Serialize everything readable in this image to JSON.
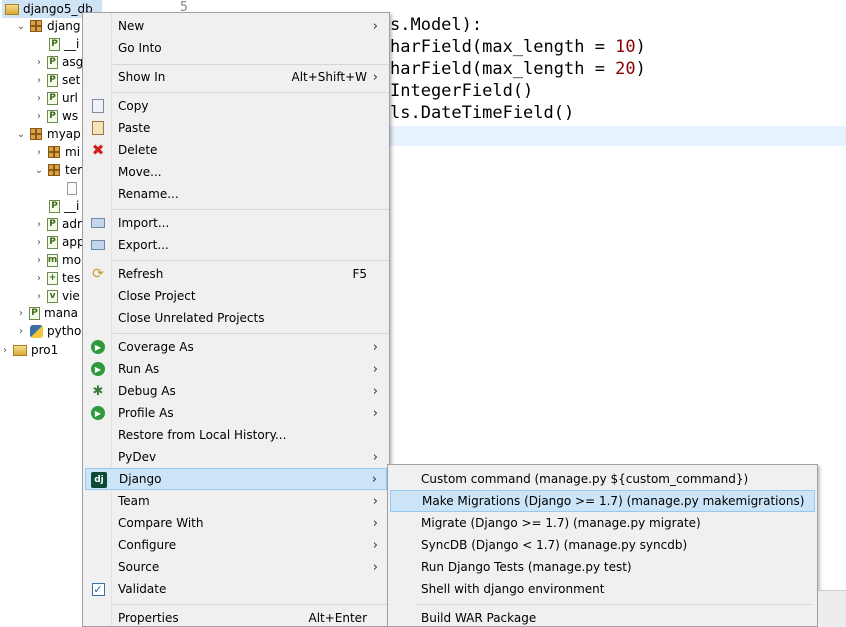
{
  "tree": {
    "items": [
      {
        "twisty": "⌄",
        "icon": "project-icon",
        "label": "django5_db"
      },
      {
        "twisty": "⌄",
        "icon": "package-icon",
        "label": "djang"
      },
      {
        "twisty": "",
        "icon": "python-file-icon",
        "label": "__i"
      },
      {
        "twisty": "›",
        "icon": "python-file-icon",
        "label": "asg"
      },
      {
        "twisty": "›",
        "icon": "python-file-icon",
        "label": "set"
      },
      {
        "twisty": "›",
        "icon": "python-file-icon",
        "label": "url"
      },
      {
        "twisty": "›",
        "icon": "python-file-icon",
        "label": "ws"
      },
      {
        "twisty": "⌄",
        "icon": "package-icon",
        "label": "myap"
      },
      {
        "twisty": "›",
        "icon": "package-icon",
        "label": "mi"
      },
      {
        "twisty": "⌄",
        "icon": "package-icon",
        "label": "ter"
      },
      {
        "twisty": "",
        "icon": "file-icon",
        "label": ""
      },
      {
        "twisty": "",
        "icon": "python-file-icon",
        "label": "__i"
      },
      {
        "twisty": "›",
        "icon": "python-file-icon",
        "label": "adr"
      },
      {
        "twisty": "›",
        "icon": "python-file-icon",
        "label": "app"
      },
      {
        "twisty": "›",
        "icon": "python-file-icon",
        "label": "mo"
      },
      {
        "twisty": "›",
        "icon": "python-file-icon",
        "label": "tes"
      },
      {
        "twisty": "›",
        "icon": "python-file-icon",
        "label": "vie"
      },
      {
        "twisty": "›",
        "icon": "python-file-icon",
        "label": "mana"
      },
      {
        "twisty": "›",
        "icon": "python-icon",
        "label": "pytho"
      },
      {
        "twisty": "›",
        "icon": "project-icon",
        "label": "pro1"
      }
    ]
  },
  "editor": {
    "line_number": "5",
    "lines": [
      {
        "text": "s.Model):",
        "num": ""
      },
      {
        "text": "harField(max_length = ",
        "num": "10",
        "end": ")"
      },
      {
        "text": "harField(max_length = ",
        "num": "20",
        "end": ")"
      },
      {
        "text": "IntegerField()",
        "num": ""
      },
      {
        "text": "ls.DateTimeField()",
        "num": ""
      }
    ]
  },
  "menu": {
    "new": "New",
    "go_into": "Go Into",
    "show_in": "Show In",
    "show_in_accel": "Alt+Shift+W",
    "copy": "Copy",
    "paste": "Paste",
    "delete": "Delete",
    "move": "Move...",
    "rename": "Rename...",
    "import": "Import...",
    "export": "Export...",
    "refresh": "Refresh",
    "refresh_accel": "F5",
    "close_project": "Close Project",
    "close_unrelated": "Close Unrelated Projects",
    "coverage_as": "Coverage As",
    "run_as": "Run As",
    "debug_as": "Debug As",
    "profile_as": "Profile As",
    "restore": "Restore from Local History...",
    "pydev": "PyDev",
    "django": "Django",
    "team": "Team",
    "compare_with": "Compare With",
    "configure": "Configure",
    "source": "Source",
    "validate": "Validate",
    "properties": "Properties",
    "properties_accel": "Alt+Enter"
  },
  "submenu": {
    "custom_command": "Custom command (manage.py ${custom_command})",
    "make_migrations": "Make Migrations (Django >= 1.7) (manage.py makemigrations)",
    "migrate": "Migrate (Django >= 1.7) (manage.py migrate)",
    "syncdb": "SyncDB (Django < 1.7) (manage.py syncdb)",
    "run_tests": "Run Django Tests (manage.py test)",
    "shell": "Shell with django environment",
    "build_war": "Build WAR Package"
  },
  "colors": {
    "highlight": "#cce4f7",
    "menu_bg": "#f0f0f0",
    "django_icon": "#0c4b33"
  }
}
